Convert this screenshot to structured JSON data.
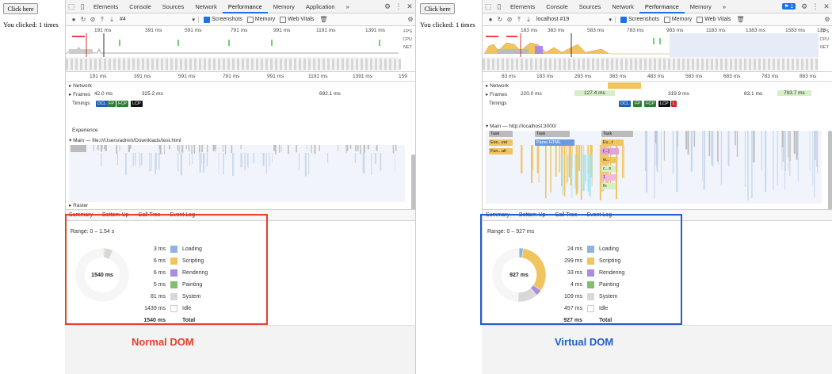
{
  "left": {
    "button_label": "Click here",
    "clicked_text": "You clicked: 1 times",
    "tabs": [
      "Elements",
      "Console",
      "Sources",
      "Network",
      "Performance",
      "Memory",
      "Application"
    ],
    "active_tab": "Performance",
    "more_tabs": "»",
    "recording": "#4",
    "checkboxes": [
      {
        "label": "Screenshots",
        "checked": true
      },
      {
        "label": "Memory",
        "checked": false
      },
      {
        "label": "Web Vitals",
        "checked": false
      }
    ],
    "overview_ticks": [
      "191 ms",
      "391 ms",
      "591 ms",
      "791 ms",
      "991 ms",
      "1191 ms",
      "1391 ms"
    ],
    "overview_labels": [
      "FPS",
      "CPU",
      "NET"
    ],
    "ruler_ticks": [
      "191 ms",
      "391 ms",
      "591 ms",
      "791 ms",
      "991 ms",
      "1191 ms",
      "1391 ms",
      "159"
    ],
    "tracks": {
      "network": "Network",
      "frames": "Frames",
      "frame_times": [
        "42.0 ms",
        "325.2 ms",
        "692.1 ms"
      ],
      "timings": "Timings",
      "timing_markers": [
        "DCL",
        "FP",
        "FCP",
        "LCP"
      ],
      "experience": "Experience",
      "main": "Main — file:///Users/admin/Downloads/test.html",
      "raster": "Raster"
    },
    "bottom_tabs": [
      "Summary",
      "Bottom-Up",
      "Call Tree",
      "Event Log"
    ],
    "range": "Range: 0 – 1.54 s",
    "donut_label": "1540 ms",
    "legend": [
      {
        "ms": "3 ms",
        "label": "Loading",
        "color": "#8fb3e0"
      },
      {
        "ms": "6 ms",
        "label": "Scripting",
        "color": "#f0c45f"
      },
      {
        "ms": "6 ms",
        "label": "Rendering",
        "color": "#a88de0"
      },
      {
        "ms": "5 ms",
        "label": "Painting",
        "color": "#7fbf6e"
      },
      {
        "ms": "81 ms",
        "label": "System",
        "color": "#d8d8d8"
      },
      {
        "ms": "1439 ms",
        "label": "Idle",
        "color": "#ffffff"
      },
      {
        "ms": "1540 ms",
        "label": "Total",
        "color": ""
      }
    ],
    "caption": "Normal DOM",
    "caption_color": "#e8402a"
  },
  "right": {
    "button_label": "Click here",
    "clicked_text": "You clicked: 1 times",
    "tabs": [
      "Elements",
      "Console",
      "Sources",
      "Network",
      "Performance",
      "Memory"
    ],
    "active_tab": "Performance",
    "more_tabs": "»",
    "badge": "1",
    "recording": "localhost #19",
    "checkboxes": [
      {
        "label": "Screenshots",
        "checked": true
      },
      {
        "label": "Memory",
        "checked": false
      },
      {
        "label": "Web Vitals",
        "checked": false
      }
    ],
    "overview_ticks": [
      "183 ms",
      "383 ms",
      "583 ms",
      "783 ms",
      "983 ms",
      "1183 ms",
      "1383 ms",
      "1583 ms",
      "178"
    ],
    "overview_labels": [
      "FPS",
      "CPU",
      "NET"
    ],
    "ruler_ticks": [
      "83 ms",
      "183 ms",
      "283 ms",
      "383 ms",
      "483 ms",
      "583 ms",
      "683 ms",
      "783 ms",
      "883 ms"
    ],
    "tracks": {
      "network": "Network",
      "frames": "Frames",
      "frame_times": [
        "220.0 ms",
        "127.4 ms",
        "319.9 ms",
        "83.1 ms",
        "793.7 ms"
      ],
      "timings": "Timings",
      "timing_markers": [
        "DCL",
        "FP",
        "FCP",
        "LCP",
        "L"
      ],
      "main": "Main — http://localhost:3000/",
      "tasks": [
        "Task",
        "Task",
        "Task",
        "Eve...ver",
        "Parse HTML",
        "Ev...t",
        "Fun...all",
        "(...)",
        "w...",
        "c...s",
        "1",
        "fn"
      ]
    },
    "bottom_tabs": [
      "Summary",
      "Bottom-Up",
      "Call Tree",
      "Event Log"
    ],
    "range": "Range: 0 – 927 ms",
    "donut_label": "927 ms",
    "legend": [
      {
        "ms": "24 ms",
        "label": "Loading",
        "color": "#8fb3e0"
      },
      {
        "ms": "299 ms",
        "label": "Scripting",
        "color": "#f0c45f"
      },
      {
        "ms": "33 ms",
        "label": "Rendering",
        "color": "#a88de0"
      },
      {
        "ms": "4 ms",
        "label": "Painting",
        "color": "#7fbf6e"
      },
      {
        "ms": "109 ms",
        "label": "System",
        "color": "#d8d8d8"
      },
      {
        "ms": "457 ms",
        "label": "Idle",
        "color": "#ffffff"
      },
      {
        "ms": "927 ms",
        "label": "Total",
        "color": ""
      }
    ],
    "caption": "Virtual DOM",
    "caption_color": "#1f5fc7"
  }
}
